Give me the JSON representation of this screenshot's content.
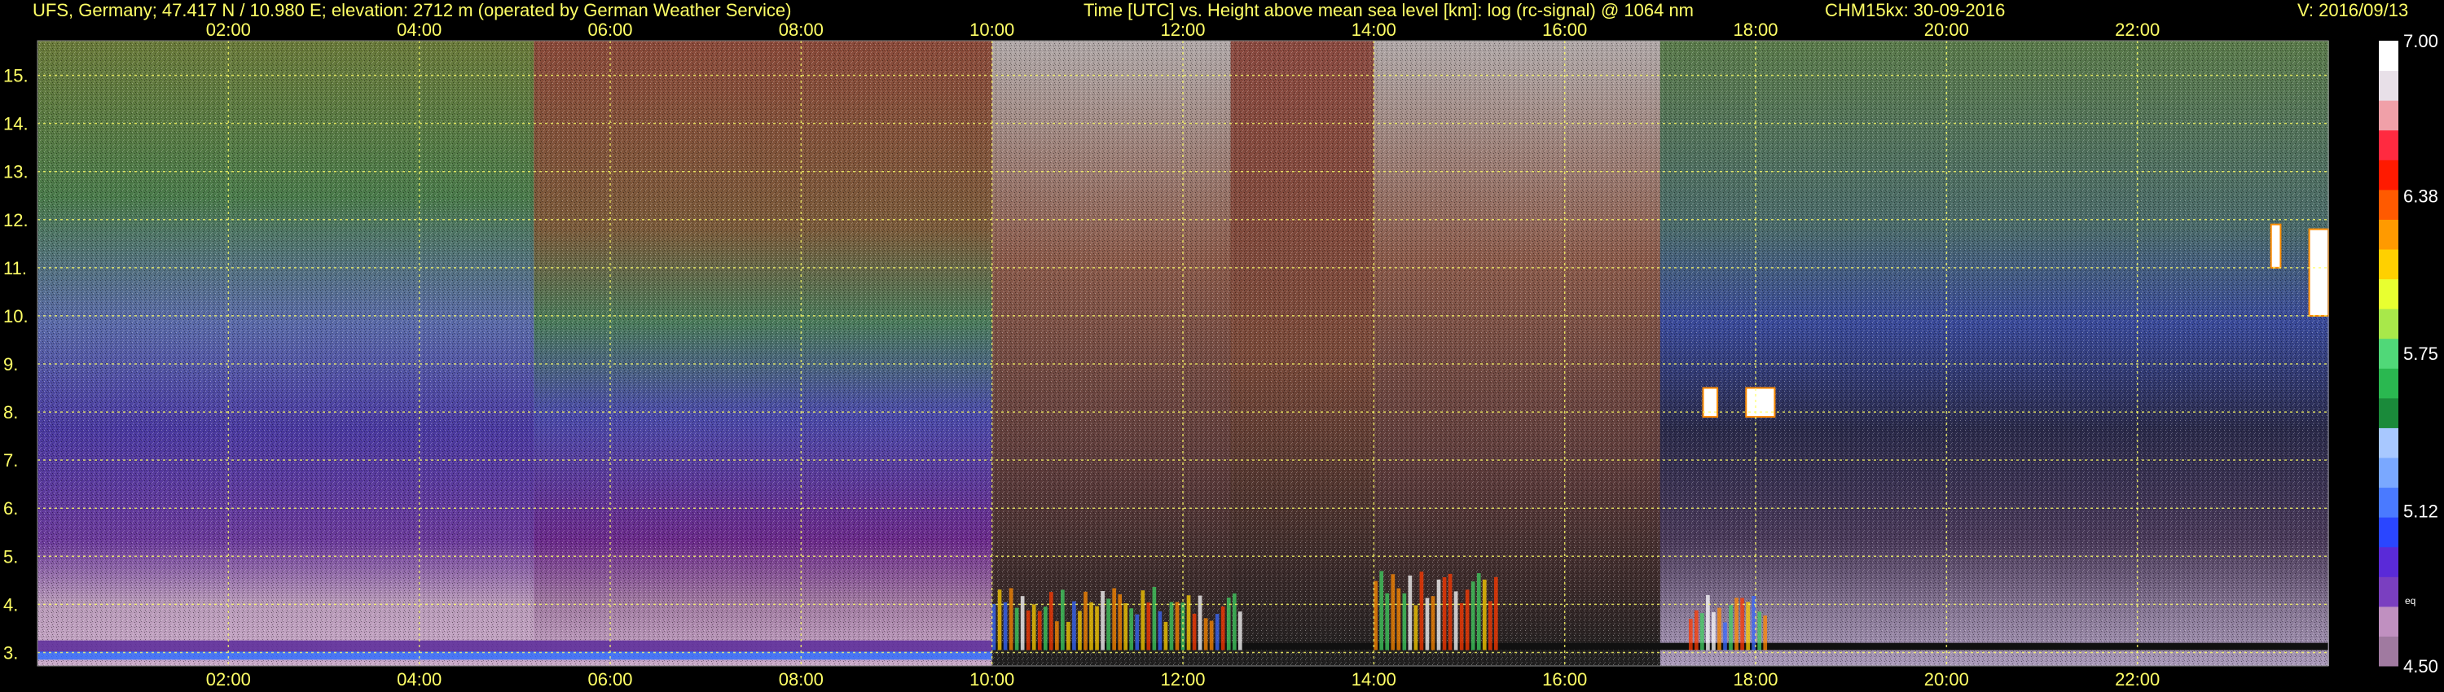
{
  "header": {
    "station": "UFS, Germany; 47.417 N / 10.980 E; elevation: 2712 m  (operated by German Weather Service)",
    "axes_title": "Time [UTC] vs. Height above mean sea level [km]: log (rc-signal) @ 1064 nm",
    "instrument": "CHM15kx: 30-09-2016",
    "version": "V: 2016/09/13"
  },
  "colors": {
    "text": "#ffff66",
    "grid": "#ffff66",
    "background": "#000000"
  },
  "chart_data": {
    "type": "heatmap",
    "title": "Time [UTC] vs. Height above mean sea level [km]: log (rc-signal) @ 1064 nm",
    "x_ticks": [
      "02:00",
      "04:00",
      "06:00",
      "08:00",
      "10:00",
      "12:00",
      "14:00",
      "16:00",
      "18:00",
      "20:00",
      "22:00"
    ],
    "x_tick_hours": [
      2,
      4,
      6,
      8,
      10,
      12,
      14,
      16,
      18,
      20,
      22
    ],
    "xlim_hours": [
      0,
      24
    ],
    "y_ticks": [
      "3.",
      "4.",
      "5.",
      "6.",
      "7.",
      "8.",
      "9.",
      "10.",
      "11.",
      "12.",
      "13.",
      "14.",
      "15."
    ],
    "y_tick_values": [
      3,
      4,
      5,
      6,
      7,
      8,
      9,
      10,
      11,
      12,
      13,
      14,
      15
    ],
    "ylim_km": [
      2.72,
      15.72
    ],
    "grid": true,
    "colorbar": {
      "ticks": [
        "7.00",
        "6.38",
        "5.75",
        "5.12",
        "4.50"
      ],
      "tick_values": [
        7.0,
        6.38,
        5.75,
        5.12,
        4.5
      ],
      "range": [
        4.5,
        7.0
      ],
      "small_label": "eq",
      "colors": [
        "#a07aa0",
        "#c090c0",
        "#7a3fc0",
        "#5a2ad8",
        "#2a46ff",
        "#4a7aff",
        "#7aa8ff",
        "#a8c8ff",
        "#1a8a3a",
        "#2ab850",
        "#50d878",
        "#a8e84a",
        "#e8ff30",
        "#ffd000",
        "#ff9a00",
        "#ff5a00",
        "#ff1a00",
        "#ff2a40",
        "#f0a0a8",
        "#e8e0e8",
        "#ffffff"
      ]
    },
    "regions": [
      {
        "from_h": 0,
        "to_h": 5.2,
        "pattern": "green-blue-purple noise increasing downward"
      },
      {
        "from_h": 5.2,
        "to_h": 10,
        "pattern": "red/brown noise aloft, green-blue mid, purple near ground"
      },
      {
        "from_h": 10,
        "to_h": 12.5,
        "pattern": "white/red noise aloft, convective plumes below 4.7 km"
      },
      {
        "from_h": 12.5,
        "to_h": 14,
        "pattern": "red noise aloft, sparse plumes"
      },
      {
        "from_h": 14,
        "to_h": 17,
        "pattern": "white/red noise aloft, strong plumes 14-15.2 h"
      },
      {
        "from_h": 17,
        "to_h": 24,
        "pattern": "green-purple noise aloft, black/purple lower levels"
      }
    ],
    "features": [
      {
        "kind": "cloud",
        "h_from": 17.45,
        "h_to": 17.6,
        "km_from": 7.9,
        "km_to": 8.5
      },
      {
        "kind": "cloud",
        "h_from": 17.9,
        "h_to": 18.2,
        "km_from": 7.9,
        "km_to": 8.5
      },
      {
        "kind": "cloud",
        "h_from": 23.8,
        "h_to": 24.0,
        "km_from": 10.0,
        "km_to": 11.8
      },
      {
        "kind": "cloud",
        "h_from": 23.4,
        "h_to": 23.5,
        "km_from": 11.0,
        "km_to": 11.9
      }
    ]
  }
}
